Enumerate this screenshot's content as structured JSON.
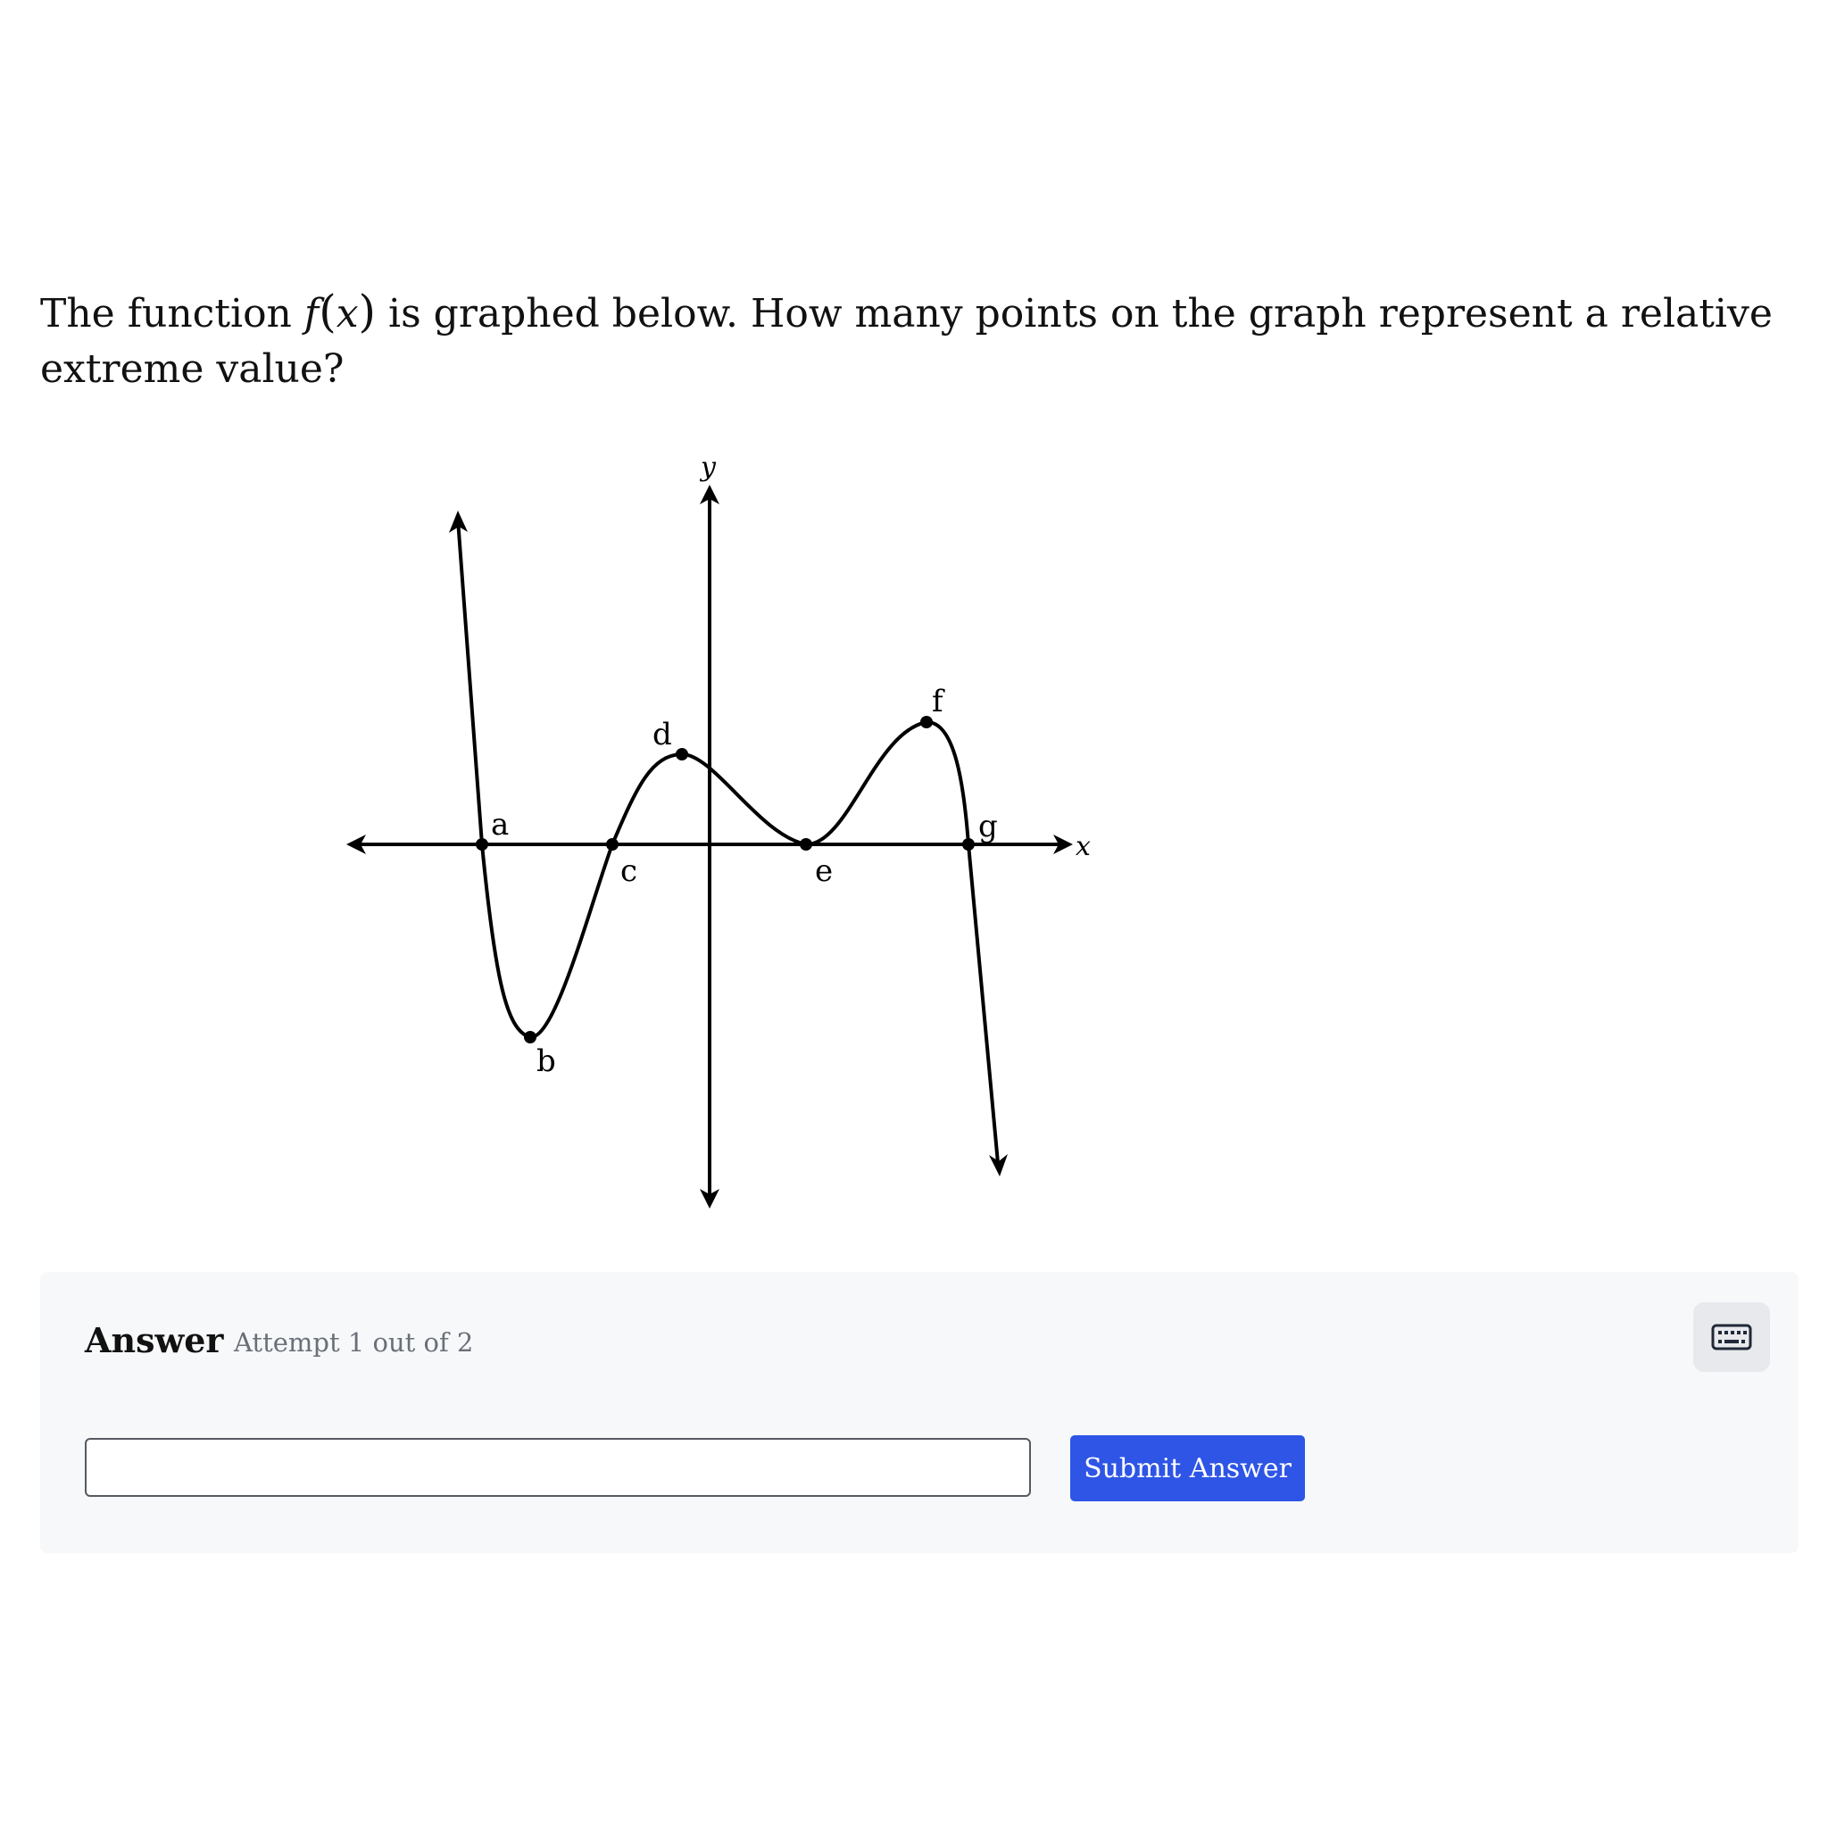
{
  "question": {
    "prefix": "The function ",
    "func_name": "f",
    "func_var": "x",
    "suffix": " is graphed below. How many points on the graph represent a relative extreme value?"
  },
  "graph": {
    "axis_x_label": "x",
    "axis_y_label": "y",
    "point_labels": [
      "a",
      "b",
      "c",
      "d",
      "e",
      "f",
      "g"
    ]
  },
  "answer": {
    "title": "Answer",
    "attempt": "Attempt 1 out of 2",
    "input_value": "",
    "input_placeholder": "",
    "submit_label": "Submit Answer",
    "keyboard_icon": "keyboard-icon"
  },
  "colors": {
    "submit_button": "#2e55e6",
    "panel_background": "#f7f8fa"
  }
}
